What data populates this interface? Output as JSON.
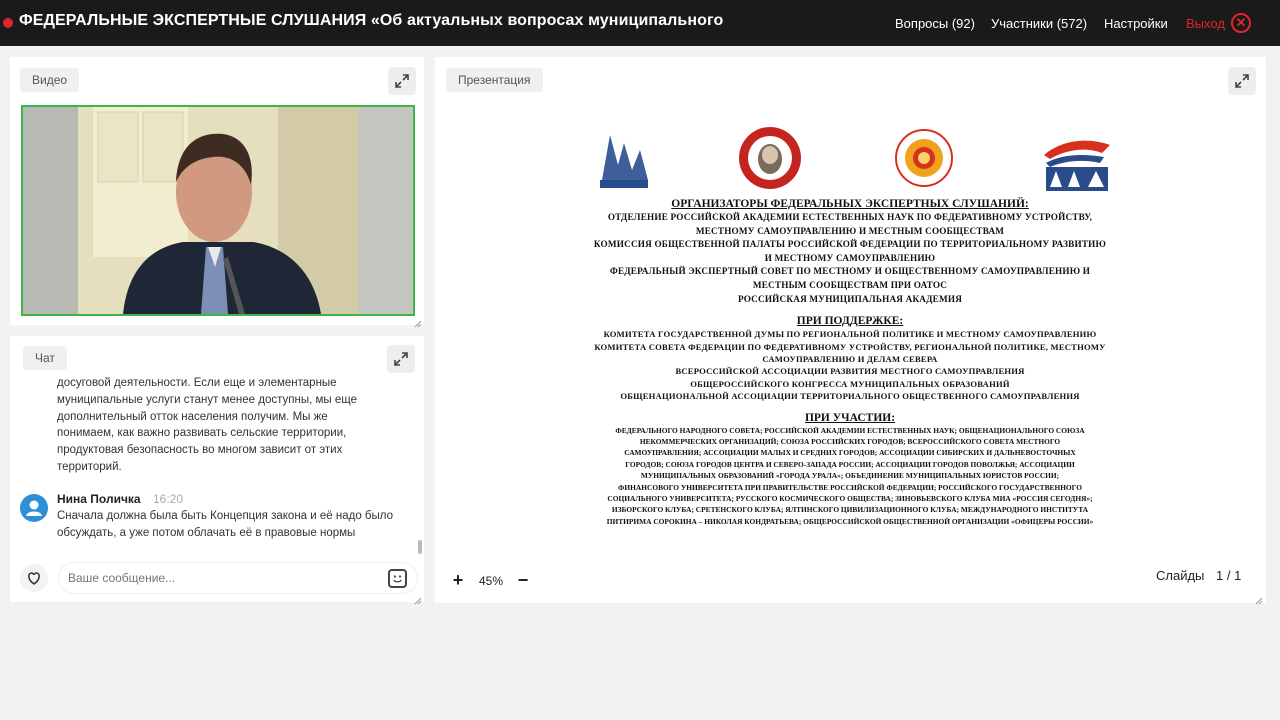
{
  "header": {
    "title": "ФЕДЕРАЛЬНЫЕ ЭКСПЕРТНЫЕ СЛУШАНИЯ «Об актуальных вопросах муниципального",
    "nav": {
      "questions": "Вопросы (92)",
      "participants": "Участники (572)",
      "settings": "Настройки",
      "exit": "Выход"
    }
  },
  "video": {
    "label": "Видео"
  },
  "chat": {
    "label": "Чат",
    "prev_message_lines": [
      "досуговой деятельности. Если еще и элементарные",
      "муниципальные услуги станут менее доступны, мы еще",
      "дополнительный отток населения получим. Мы же",
      "понимаем, как важно развивать сельские территории,",
      "продуктовая безопасность во многом зависит от этих",
      "территорий."
    ],
    "message": {
      "author": "Нина Поличка",
      "time": "16:20",
      "text": "Сначала должна была быть Концепция закона и её надо было обсуждать, а уже потом облачать её в правовые нормы"
    },
    "input_placeholder": "Ваше сообщение..."
  },
  "presentation": {
    "label": "Презентация",
    "zoom": "45%",
    "zoom_in": "+",
    "zoom_out": "−",
    "slides_label": "Слайды",
    "slides_count": "1 / 1",
    "slide": {
      "organizers_heading": "ОРГАНИЗАТОРЫ ФЕДЕРАЛЬНЫХ ЭКСПЕРТНЫХ СЛУШАНИЙ:",
      "organizers": [
        "ОТДЕЛЕНИЕ РОССИЙСКОЙ АКАДЕМИИ ЕСТЕСТВЕННЫХ НАУК ПО ФЕДЕРАТИВНОМУ УСТРОЙСТВУ,",
        "МЕСТНОМУ САМОУПРАВЛЕНИЮ И МЕСТНЫМ СООБЩЕСТВАМ",
        "КОМИССИЯ ОБЩЕСТВЕННОЙ ПАЛАТЫ РОССИЙСКОЙ ФЕДЕРАЦИИ ПО ТЕРРИТОРИАЛЬНОМУ РАЗВИТИЮ",
        "И МЕСТНОМУ САМОУПРАВЛЕНИЮ",
        "ФЕДЕРАЛЬНЫЙ ЭКСПЕРТНЫЙ СОВЕТ ПО МЕСТНОМУ И ОБЩЕСТВЕННОМУ САМОУПРАВЛЕНИЮ И",
        "МЕСТНЫМ СООБЩЕСТВАМ ПРИ ОАТОС",
        "РОССИЙСКАЯ МУНИЦИПАЛЬНАЯ АКАДЕМИЯ"
      ],
      "support_heading": "ПРИ ПОДДЕРЖКЕ:",
      "support": [
        "КОМИТЕТА ГОСУДАРСТВЕННОЙ ДУМЫ ПО РЕГИОНАЛЬНОЙ ПОЛИТИКЕ И МЕСТНОМУ САМОУПРАВЛЕНИЮ",
        "КОМИТЕТА СОВЕТА ФЕДЕРАЦИИ ПО ФЕДЕРАТИВНОМУ УСТРОЙСТВУ, РЕГИОНАЛЬНОЙ ПОЛИТИКЕ, МЕСТНОМУ",
        "САМОУПРАВЛЕНИЮ И ДЕЛАМ СЕВЕРА",
        "ВСЕРОССИЙСКОЙ АССОЦИАЦИИ РАЗВИТИЯ МЕСТНОГО САМОУПРАВЛЕНИЯ",
        "ОБЩЕРОССИЙСКОГО КОНГРЕССА МУНИЦИПАЛЬНЫХ ОБРАЗОВАНИЙ",
        "ОБЩЕНАЦИОНАЛЬНОЙ АССОЦИАЦИИ ТЕРРИТОРИАЛЬНОГО ОБЩЕСТВЕННОГО САМОУПРАВЛЕНИЯ"
      ],
      "participation_heading": "ПРИ УЧАСТИИ:",
      "participation": [
        "ФЕДЕРАЛЬНОГО НАРОДНОГО СОВЕТА; РОССИЙСКОЙ АКАДЕМИИ ЕСТЕСТВЕННЫХ НАУК; ОБЩЕНАЦИОНАЛЬНОГО СОЮЗА",
        "НЕКОММЕРЧЕСКИХ ОРГАНИЗАЦИЙ; СОЮЗА РОССИЙСКИХ ГОРОДОВ; ВСЕРОССИЙСКОГО СОВЕТА МЕСТНОГО",
        "САМОУПРАВЛЕНИЯ; АССОЦИАЦИИ МАЛЫХ И СРЕДНИХ ГОРОДОВ; АССОЦИАЦИИ СИБИРСКИХ И ДАЛЬНЕВОСТОЧНЫХ",
        "ГОРОДОВ; СОЮЗА ГОРОДОВ ЦЕНТРА И СЕВЕРО-ЗАПАДА РОССИИ; АССОЦИАЦИИ ГОРОДОВ ПОВОЛЖЬЯ; АССОЦИАЦИИ",
        "МУНИЦИПАЛЬНЫХ ОБРАЗОВАНИЙ «ГОРОДА УРАЛА»; ОБЪЕДИНЕНИЕ МУНИЦИПАЛЬНЫХ ЮРИСТОВ РОССИИ;",
        "ФИНАНСОВОГО УНИВЕРСИТЕТА ПРИ ПРАВИТЕЛЬСТВЕ РОССИЙСКОЙ ФЕДЕРАЦИИ; РОССИЙСКОГО ГОСУДАРСТВЕННОГО",
        "СОЦИАЛЬНОГО УНИВЕРСИТЕТА; РУССКОГО КОСМИЧЕСКОГО ОБЩЕСТВА; ЗИНОВЬЕВСКОГО КЛУБА МИА «РОССИЯ СЕГОДНЯ»;",
        "ИЗБОРСКОГО КЛУБА; СРЕТЕНСКОГО КЛУБА; ЯЛТИНСКОГО ЦИВИЛИЗАЦИОННОГО КЛУБА; МЕЖДУНАРОДНОГО ИНСТИТУТА",
        "ПИТИРИМА СОРОКИНА – НИКОЛАЯ КОНДРАТЬЕВА; ОБЩЕРОССИЙСКОЙ ОБЩЕСТВЕННОЙ ОРГАНИЗАЦИИ «ОФИЦЕРЫ РОССИИ»"
      ],
      "logos": [
        "civic-chamber-logo",
        "academy-logo",
        "expert-council-logo",
        "rma-logo"
      ]
    }
  },
  "colors": {
    "accent_red": "#e0262b",
    "video_border": "#3cb54a",
    "topbar": "#1a1a1a"
  }
}
